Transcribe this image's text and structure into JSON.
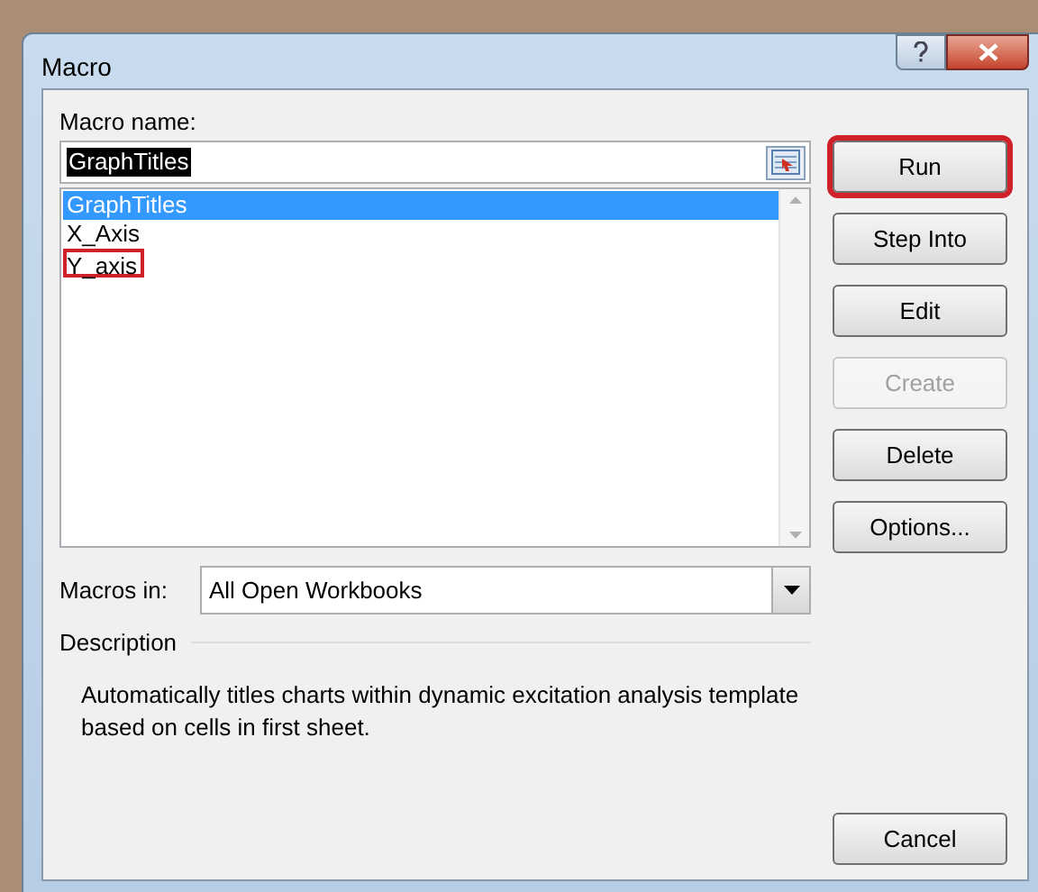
{
  "window": {
    "title": "Macro"
  },
  "macro_name": {
    "label": "Macro name:",
    "value": "GraphTitles"
  },
  "macros": [
    {
      "label": "GraphTitles",
      "selected": true,
      "annotated": false
    },
    {
      "label": "X_Axis",
      "selected": false,
      "annotated": false
    },
    {
      "label": "Y_axis",
      "selected": false,
      "annotated": true
    }
  ],
  "buttons": [
    {
      "label": "Run",
      "disabled": false,
      "annotated": true
    },
    {
      "label": "Step Into",
      "disabled": false,
      "annotated": false
    },
    {
      "label": "Edit",
      "disabled": false,
      "annotated": false
    },
    {
      "label": "Create",
      "disabled": true,
      "annotated": false
    },
    {
      "label": "Delete",
      "disabled": false,
      "annotated": false
    },
    {
      "label": "Options...",
      "disabled": false,
      "annotated": false
    }
  ],
  "macros_in": {
    "label": "Macros in:",
    "value": "All Open Workbooks"
  },
  "description": {
    "label": "Description",
    "text": "Automatically titles charts within dynamic excitation analysis template based on cells in first sheet."
  },
  "cancel_button": "Cancel"
}
